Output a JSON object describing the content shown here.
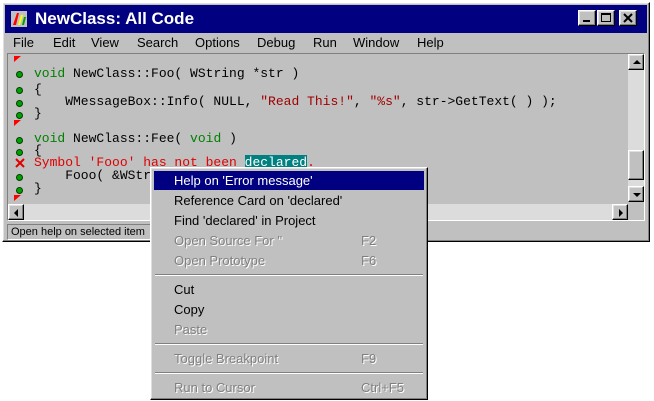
{
  "window": {
    "title": "NewClass: All Code"
  },
  "menu": [
    {
      "label": "File"
    },
    {
      "label": "Edit"
    },
    {
      "label": "View"
    },
    {
      "label": "Search"
    },
    {
      "label": "Options"
    },
    {
      "label": "Debug"
    },
    {
      "label": "Run"
    },
    {
      "label": "Window"
    },
    {
      "label": "Help"
    }
  ],
  "code": {
    "l1a": "void",
    "l1b": " NewClass::Foo( WString *str )",
    "l2": "{",
    "l3a": "    WMessageBox::Info( NULL, ",
    "l3s1": "\"Read This!\"",
    "l3b": ", ",
    "l3s2": "\"%s\"",
    "l3c": ", str->GetText( ) );",
    "l4": "}",
    "l5a": "void",
    "l5b": " NewClass::Fee( ",
    "l5c": "void",
    "l5d": " )",
    "l6": "{",
    "l7a": "Symbol 'Fooo' has not been ",
    "l7hl": "declared",
    "l7b": ".",
    "l8": "    Fooo( &WStr",
    "l9": "}"
  },
  "status": {
    "text": "Open help on selected item"
  },
  "context_menu": {
    "items": [
      {
        "label": "Help on 'Error message'",
        "shortcut": "",
        "selected": true,
        "disabled": false
      },
      {
        "label": "Reference Card on 'declared'",
        "shortcut": "",
        "selected": false,
        "disabled": false
      },
      {
        "label": "Find 'declared' in Project",
        "shortcut": "",
        "selected": false,
        "disabled": false
      },
      {
        "label": "Open Source For ''",
        "shortcut": "F2",
        "selected": false,
        "disabled": true
      },
      {
        "label": "Open Prototype",
        "shortcut": "F6",
        "selected": false,
        "disabled": true
      },
      {
        "label": "Cut",
        "shortcut": "",
        "selected": false,
        "disabled": false
      },
      {
        "label": "Copy",
        "shortcut": "",
        "selected": false,
        "disabled": false
      },
      {
        "label": "Paste",
        "shortcut": "",
        "selected": false,
        "disabled": true
      },
      {
        "label": "Toggle Breakpoint",
        "shortcut": "F9",
        "selected": false,
        "disabled": true
      },
      {
        "label": "Run to Cursor",
        "shortcut": "Ctrl+F5",
        "selected": false,
        "disabled": true
      }
    ]
  },
  "colors": {
    "titlebar": "#000080",
    "keyword": "#008000",
    "error": "#e00000",
    "highlight": "#008080"
  },
  "icons": [
    "app-icon",
    "minimize-icon",
    "maximize-icon",
    "close-icon",
    "breakpoint-marker-icon",
    "error-x-icon"
  ]
}
